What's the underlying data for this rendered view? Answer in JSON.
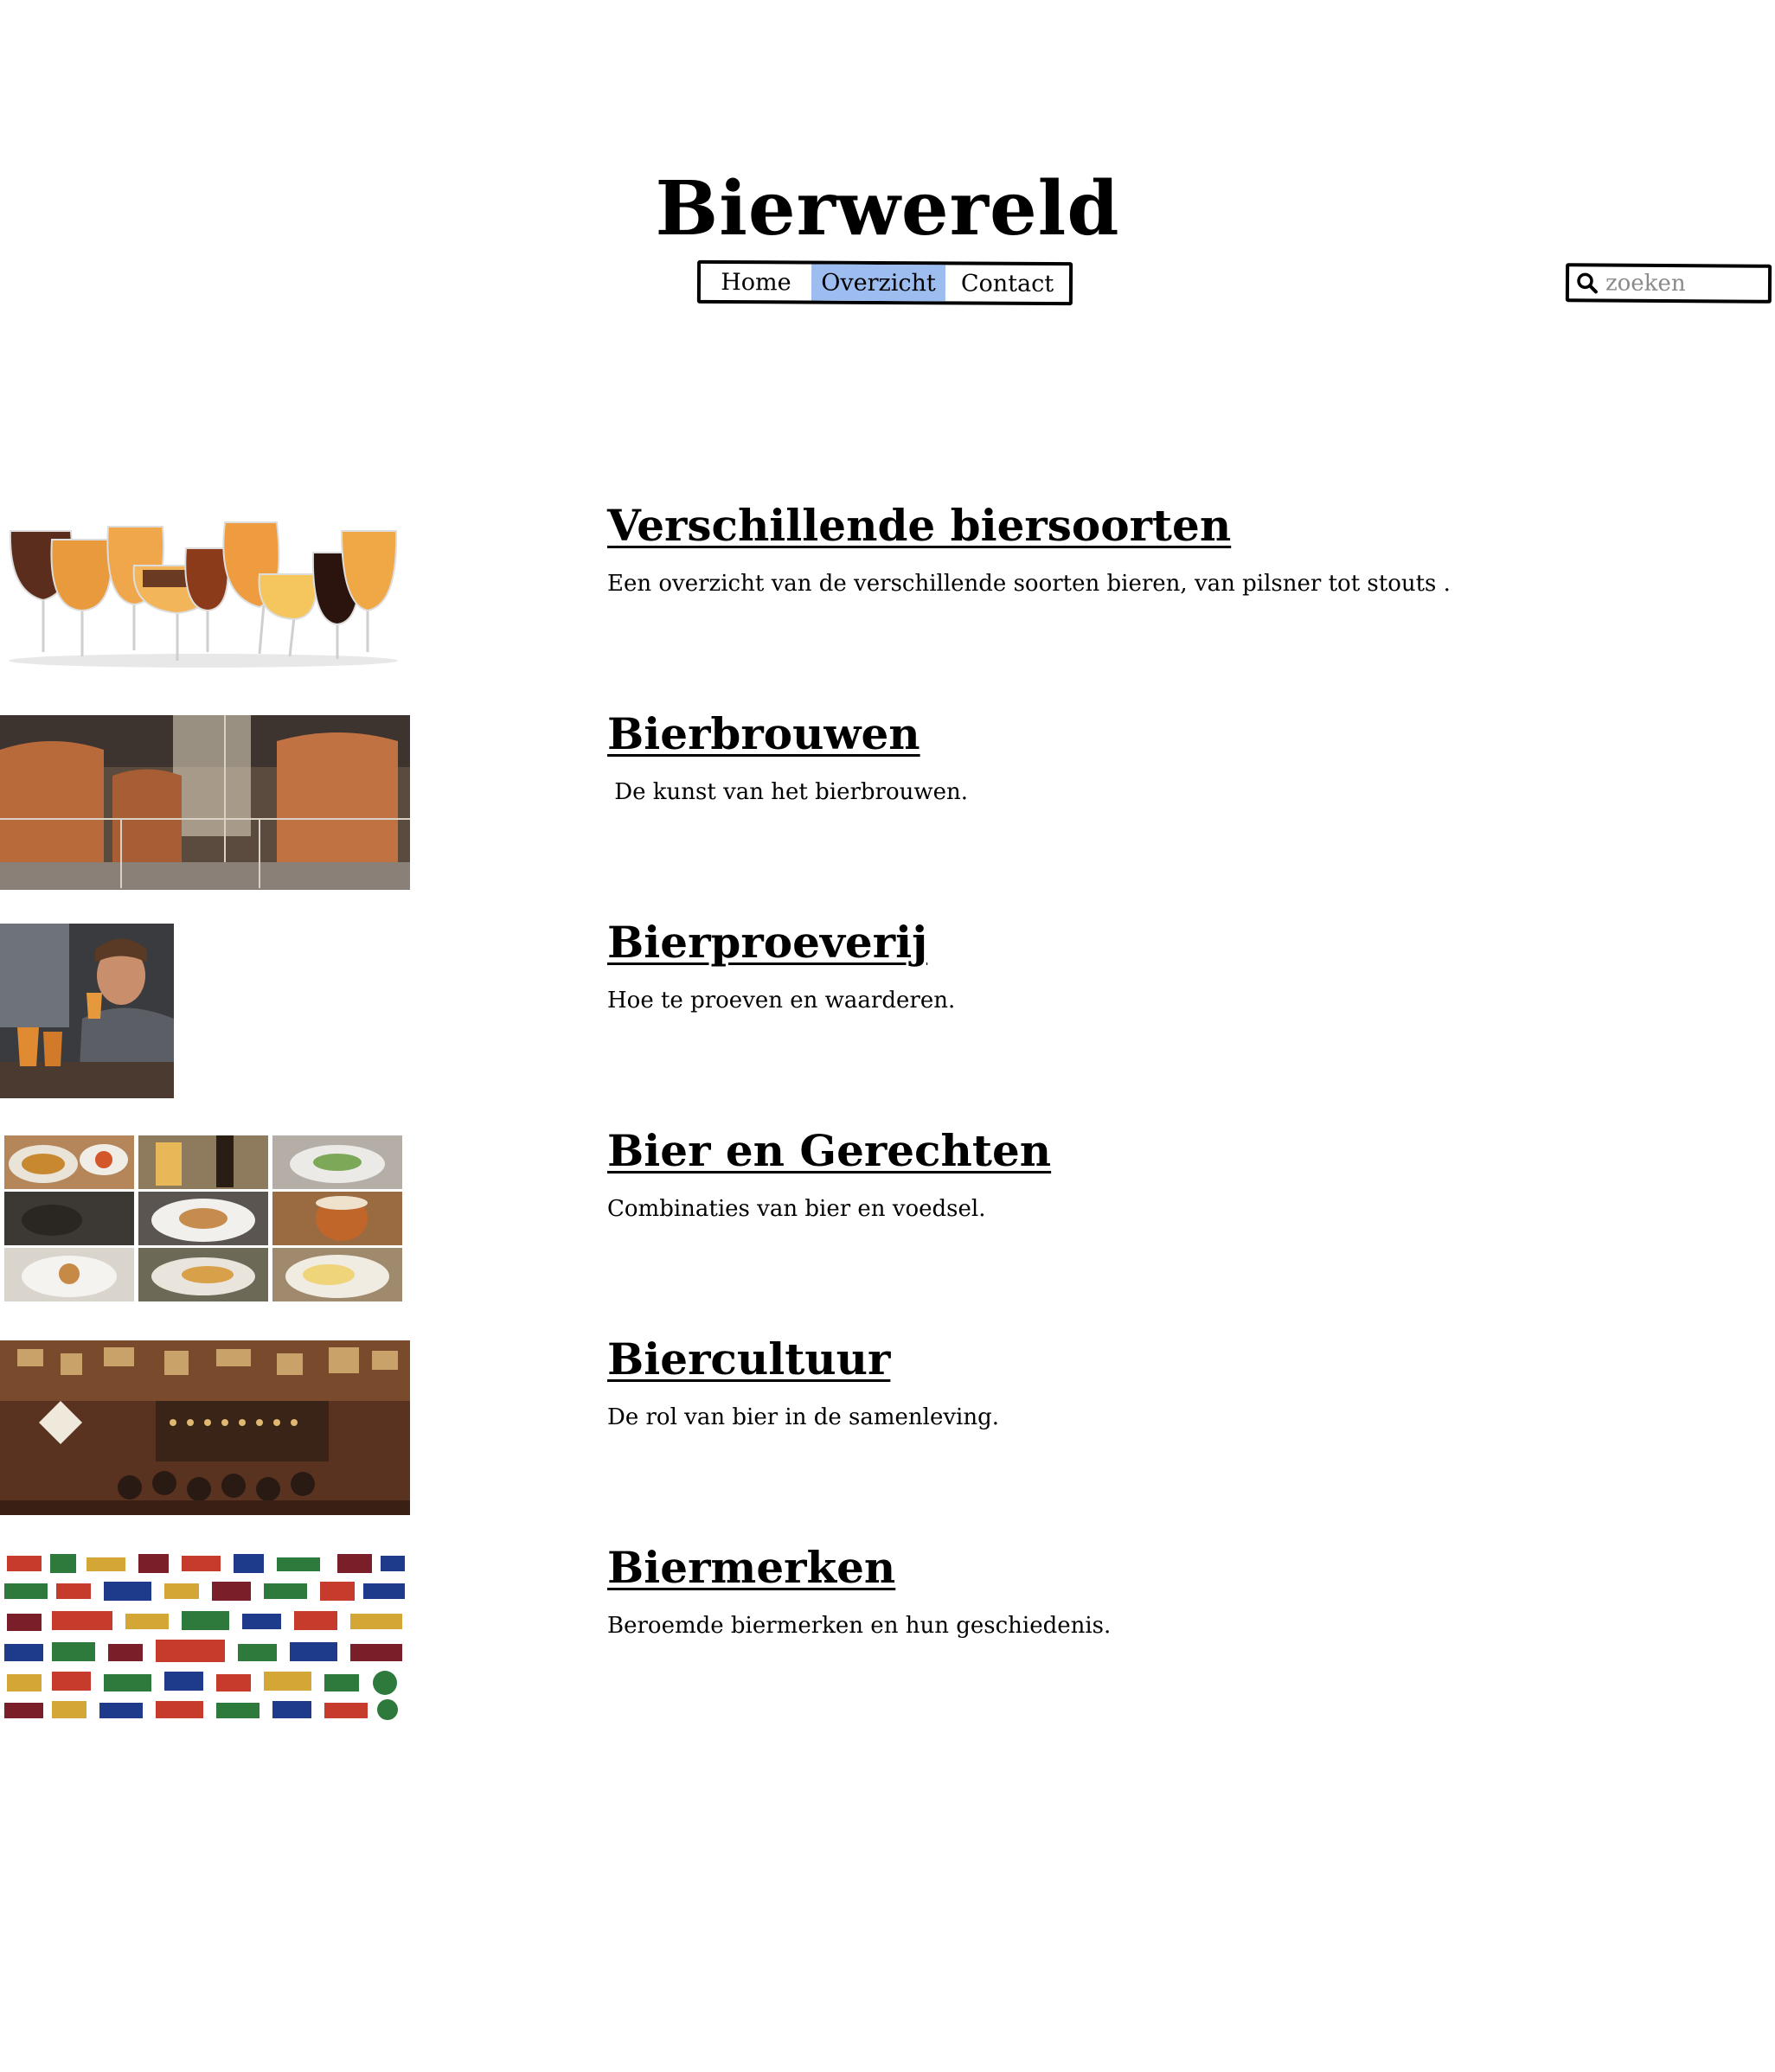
{
  "header": {
    "site_title": "Bierwereld"
  },
  "nav": {
    "items": [
      {
        "label": "Home",
        "active": false
      },
      {
        "label": "Overzicht",
        "active": true
      },
      {
        "label": "Contact",
        "active": false
      }
    ]
  },
  "search": {
    "placeholder": "zoeken",
    "value": ""
  },
  "sections": [
    {
      "title": "Verschillende biersoorten",
      "description": "Een overzicht van de verschillende soorten bieren, van pilsner tot stouts ."
    },
    {
      "title": "Bierbrouwen",
      "description": " De kunst van het bierbrouwen."
    },
    {
      "title": "Bierproeverij",
      "description": "Hoe te proeven en waarderen."
    },
    {
      "title": "Bier en Gerechten",
      "description": "Combinaties van bier en voedsel."
    },
    {
      "title": "Biercultuur",
      "description": "De rol van bier in de samenleving."
    },
    {
      "title": "Biermerken",
      "description": "Beroemde biermerken en hun geschiedenis."
    }
  ],
  "colors": {
    "nav_active": "#9dbdf0",
    "border": "#000000",
    "placeholder": "#8a8a8a"
  }
}
